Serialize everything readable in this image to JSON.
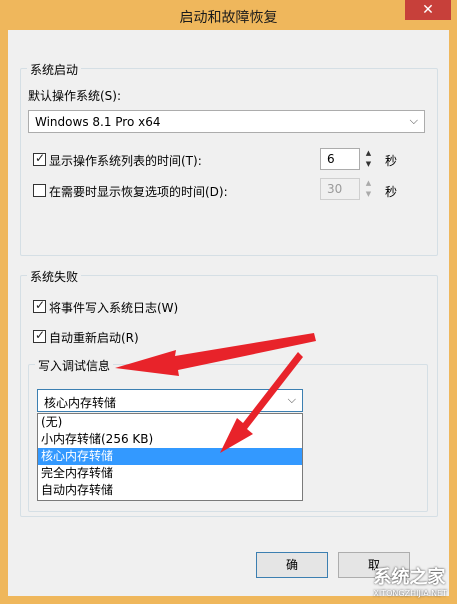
{
  "window": {
    "title": "启动和故障恢复",
    "close_glyph": "✕"
  },
  "startup": {
    "legend": "系统启动",
    "default_os_label": "默认操作系统(S):",
    "default_os_value": "Windows 8.1 Pro x64",
    "show_list": {
      "label": "显示操作系统列表的时间(T):",
      "checked": true,
      "value": "6",
      "unit": "秒"
    },
    "show_recovery": {
      "label": "在需要时显示恢复选项的时间(D):",
      "checked": false,
      "value": "30",
      "unit": "秒"
    }
  },
  "failure": {
    "legend": "系统失败",
    "write_event": {
      "label": "将事件写入系统日志(W)",
      "checked": true
    },
    "auto_restart": {
      "label": "自动重新启动(R)",
      "checked": true
    },
    "debug_label": "写入调试信息",
    "debug_selected": "核心内存转储",
    "debug_options": [
      "(无)",
      "小内存转储(256 KB)",
      "核心内存转储",
      "完全内存转储",
      "自动内存转储"
    ]
  },
  "buttons": {
    "ok": "确",
    "cancel": "取"
  },
  "watermark": {
    "text": "系统之家",
    "sub": "XITONGZHIJIA.NET"
  },
  "colors": {
    "accent": "#3399ff",
    "annotation": "#e8232a",
    "frame": "#efb75c"
  }
}
